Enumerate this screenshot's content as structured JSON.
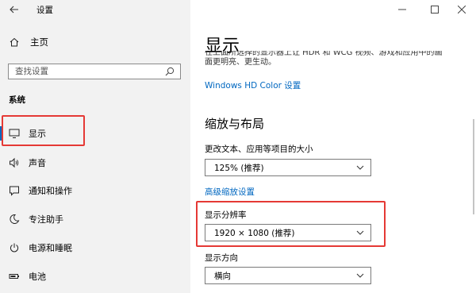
{
  "window": {
    "title": "设置",
    "controls": [
      "minimize",
      "maximize",
      "close"
    ]
  },
  "sidebar": {
    "home_label": "主页",
    "search_placeholder": "查找设置",
    "section_title": "系统",
    "items": [
      {
        "label": "显示",
        "icon": "monitor-icon",
        "active": true
      },
      {
        "label": "声音",
        "icon": "speaker-icon"
      },
      {
        "label": "通知和操作",
        "icon": "notification-icon"
      },
      {
        "label": "专注助手",
        "icon": "moon-icon"
      },
      {
        "label": "电源和睡眠",
        "icon": "power-icon"
      },
      {
        "label": "电池",
        "icon": "battery-icon"
      }
    ]
  },
  "main": {
    "title": "显示",
    "clipped_text_line1": "在上面所选择的显示器上让 HDR 和 WCG 视频、游戏和应用中的画",
    "clipped_text_line2": "面更明亮、更生动。",
    "hd_color_link": "Windows HD Color 设置",
    "scale_section_title": "缩放与布局",
    "text_size_label": "更改文本、应用等项目的大小",
    "text_size_value": "125% (推荐)",
    "advanced_scaling_link": "高级缩放设置",
    "resolution_label": "显示分辨率",
    "resolution_value": "1920 × 1080 (推荐)",
    "orientation_label": "显示方向",
    "orientation_value": "横向"
  },
  "colors": {
    "accent": "#0067c0",
    "highlight_box": "#e53935",
    "sidebar_bg": "#f2f2f2"
  }
}
